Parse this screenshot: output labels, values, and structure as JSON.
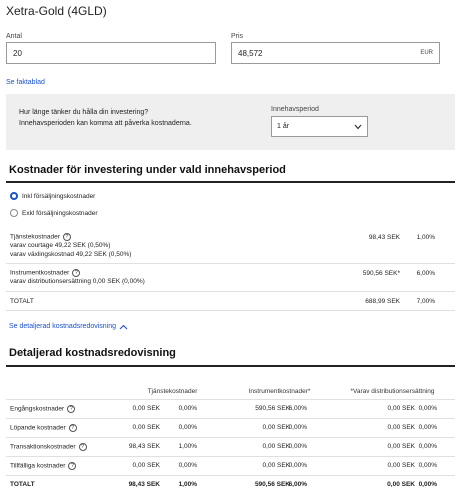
{
  "page_title": "Xetra-Gold (4GLD)",
  "quantity": {
    "label": "Antal",
    "value": "20"
  },
  "price": {
    "label": "Pris",
    "value": "48,572",
    "unit": "EUR"
  },
  "factsheet_link": "Se faktablad",
  "holding": {
    "question": "Hur länge tänker du hålla din investering?",
    "subtext": "Innehavsperioden kan komma att påverka kostnaderna.",
    "select_label": "Innehavsperiod",
    "select_value": "1 år"
  },
  "costs": {
    "title": "Kostnader för investering under vald innehavsperiod",
    "radio_incl": "Inkl försäljningskostnader",
    "radio_excl": "Exkl försäljningskostnader",
    "rows": [
      {
        "label": "Tjänstekostnader",
        "sub1": "varav courtage 49,22 SEK (0,50%)",
        "sub2": "varav växlingskostnad 49,22 SEK (0,50%)",
        "sek": "98,43 SEK",
        "pct": "1,00%"
      },
      {
        "label": "Instrumentkostnader",
        "sub1": "varav distributionsersättning 0,00 SEK (0,00%)",
        "sub2": "",
        "sek": "590,56 SEK*",
        "pct": "6,00%"
      },
      {
        "label": "TOTALT",
        "sub1": "",
        "sub2": "",
        "sek": "688,99 SEK",
        "pct": "7,00%"
      }
    ],
    "detail_link": "Se detaljerad kostnadsredovisning"
  },
  "detail": {
    "title": "Detaljerad kostnadsredovisning",
    "headers": [
      "Tjänstekostnader",
      "Instrumentkostnader*",
      "*Varav distributionsersättning"
    ],
    "rows": [
      {
        "label": "Engångskostnader",
        "s_sek": "0,00 SEK",
        "s_pct": "0,00%",
        "i_sek": "590,56 SEK",
        "i_pct": "6,00%",
        "d_sek": "0,00 SEK",
        "d_pct": "0,00%"
      },
      {
        "label": "Löpande kostnader",
        "s_sek": "0,00 SEK",
        "s_pct": "0,00%",
        "i_sek": "0,00 SEK",
        "i_pct": "0,00%",
        "d_sek": "0,00 SEK",
        "d_pct": "0,00%"
      },
      {
        "label": "Transaktionskostnader",
        "s_sek": "98,43 SEK",
        "s_pct": "1,00%",
        "i_sek": "0,00 SEK",
        "i_pct": "0,00%",
        "d_sek": "0,00 SEK",
        "d_pct": "0,00%"
      },
      {
        "label": "Tillfälliga kostnader",
        "s_sek": "0,00 SEK",
        "s_pct": "0,00%",
        "i_sek": "0,00 SEK",
        "i_pct": "0,00%",
        "d_sek": "0,00 SEK",
        "d_pct": "0,00%"
      },
      {
        "label": "TOTALT",
        "s_sek": "98,43 SEK",
        "s_pct": "1,00%",
        "i_sek": "590,56 SEK",
        "i_pct": "6,00%",
        "d_sek": "0,00 SEK",
        "d_pct": "0,00%"
      }
    ]
  }
}
